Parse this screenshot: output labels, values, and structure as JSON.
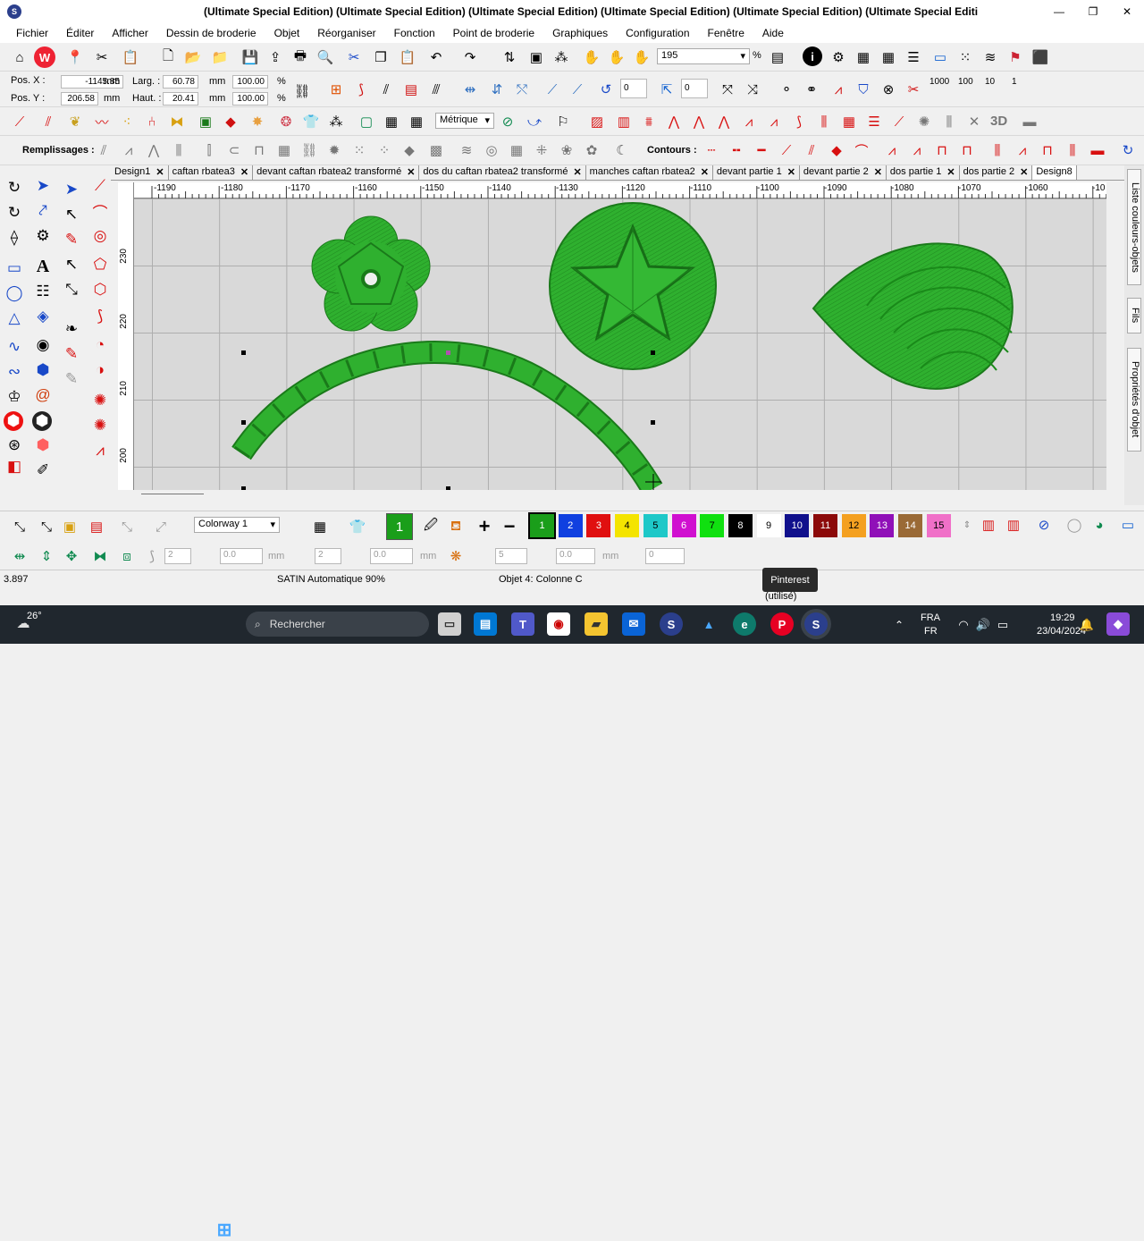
{
  "window": {
    "title": "(Ultimate Special Edition) (Ultimate Special Edition) (Ultimate Special Edition) (Ultimate Special Edition) (Ultimate Special Edition) (Ultimate Special Editi"
  },
  "menu": [
    "Fichier",
    "Éditer",
    "Afficher",
    "Dessin de broderie",
    "Objet",
    "Réorganiser",
    "Fonction",
    "Point de broderie",
    "Graphiques",
    "Configuration",
    "Fenêtre",
    "Aide"
  ],
  "toolbar": {
    "zoom_value": "195",
    "zoom_unit": "%"
  },
  "position": {
    "pos_x_label": "Pos. X :",
    "pos_x": "-1145.85",
    "pos_x_unit": "mm",
    "pos_y_label": "Pos. Y :",
    "pos_y": "206.58",
    "pos_y_unit": "mm",
    "width_label": "Larg. :",
    "width": "60.78",
    "width_unit": "mm",
    "width_pct": "100.00",
    "width_pct_unit": "%",
    "height_label": "Haut. :",
    "height": "20.41",
    "height_unit": "mm",
    "height_pct": "100.00",
    "height_pct_unit": "%",
    "rotate_value": "0",
    "slant_value": "0"
  },
  "units_select": "Métrique",
  "fill_label": "Remplissages :",
  "contour_label": "Contours :",
  "tabs": [
    "Design1",
    "caftan rbatea3",
    "devant caftan rbatea2 transformé",
    "dos du caftan rbatea2 transformé",
    "manches caftan rbatea2",
    "devant partie 1",
    "devant partie 2",
    "dos partie 1",
    "dos partie 2",
    "Design8"
  ],
  "tab_close": "✕",
  "ruler": {
    "x_ticks": [
      "-1190",
      "-1180",
      "-1170",
      "-1160",
      "-1150",
      "-1140",
      "-1130",
      "-1120",
      "-1110",
      "-1100",
      "-1090",
      "-1080",
      "-1070",
      "-1060",
      "-10"
    ],
    "y_ticks": [
      "230",
      "220",
      "210",
      "200"
    ]
  },
  "right_panels": [
    "Liste couleurs-objets",
    "Fils",
    "Propriétés d'objet"
  ],
  "colorway": "Colorway 1",
  "current_color": "1",
  "palette": [
    {
      "n": "1",
      "c": "#1a9e1a",
      "t": "#fff"
    },
    {
      "n": "2",
      "c": "#1040e0",
      "t": "#fff"
    },
    {
      "n": "3",
      "c": "#e01010",
      "t": "#fff"
    },
    {
      "n": "4",
      "c": "#f4e400",
      "t": "#000"
    },
    {
      "n": "5",
      "c": "#1ec8c8",
      "t": "#000"
    },
    {
      "n": "6",
      "c": "#d010d0",
      "t": "#fff"
    },
    {
      "n": "7",
      "c": "#10e010",
      "t": "#000"
    },
    {
      "n": "8",
      "c": "#000000",
      "t": "#fff"
    },
    {
      "n": "9",
      "c": "#ffffff",
      "t": "#000"
    },
    {
      "n": "10",
      "c": "#10108c",
      "t": "#fff"
    },
    {
      "n": "11",
      "c": "#8c0a0a",
      "t": "#fff"
    },
    {
      "n": "12",
      "c": "#f4a020",
      "t": "#000"
    },
    {
      "n": "13",
      "c": "#9010b8",
      "t": "#fff"
    },
    {
      "n": "14",
      "c": "#9a6a36",
      "t": "#fff"
    },
    {
      "n": "15",
      "c": "#f070c8",
      "t": "#000"
    }
  ],
  "bottom_fields": {
    "f1": "2",
    "f2": "0.0",
    "f3": "2",
    "f4": "0.0",
    "f5": "5",
    "f6": "0.0",
    "f7": "0",
    "unit": "mm"
  },
  "status": {
    "left": "3.897",
    "stitch": "SATIN Automatique 90%",
    "object": "Objet 4: Colonne C",
    "right": "(utilisé)"
  },
  "tooltip": "Pinterest",
  "taskbar": {
    "weather_temp": "26°",
    "search": "Rechercher",
    "lang1": "FRA",
    "lang2": "FR",
    "time": "19:29",
    "date": "23/04/2024"
  },
  "colors": {
    "embroidery": "#2fb02f",
    "accent": "#2b3f8c"
  }
}
